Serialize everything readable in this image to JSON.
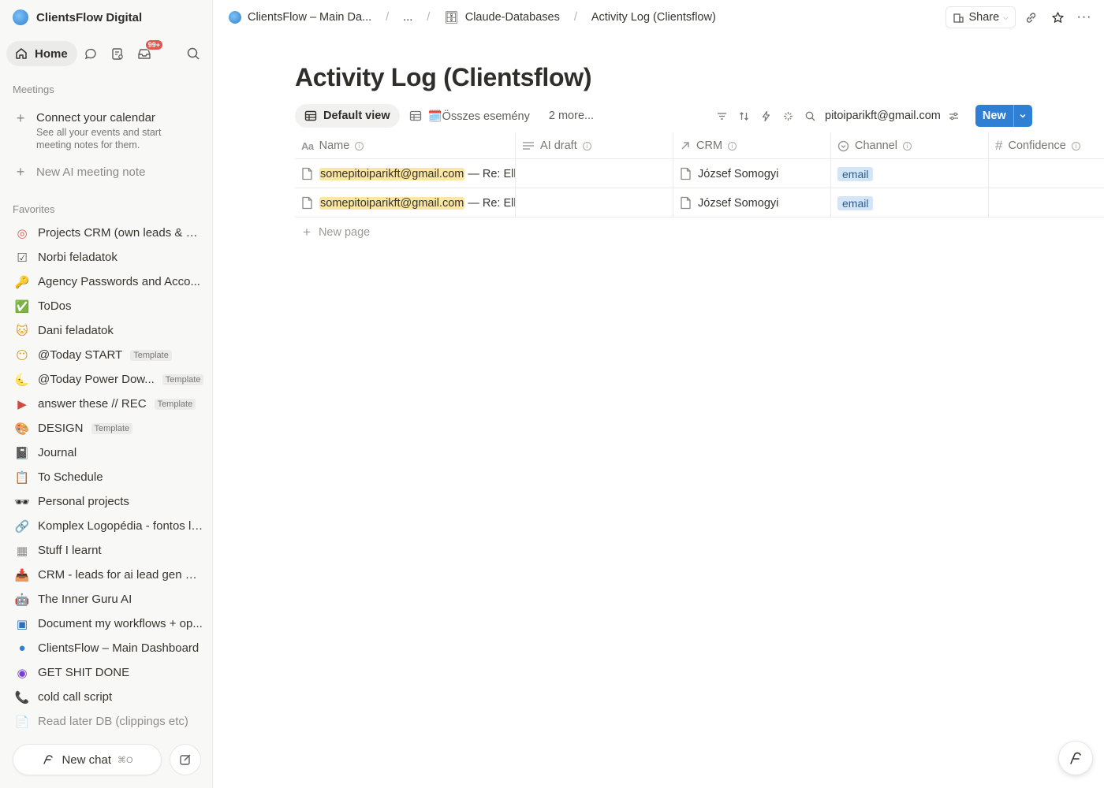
{
  "sidebar": {
    "workspace": "ClientsFlow Digital",
    "home_label": "Home",
    "inbox_badge": "99+",
    "meetings_label": "Meetings",
    "connect_calendar": "Connect your calendar",
    "connect_calendar_sub": "See all your events and start meeting notes for them.",
    "new_ai_note": "New AI meeting note",
    "favorites_label": "Favorites",
    "favorites": [
      {
        "icon": "target-icon",
        "glyph": "◎",
        "color": "#e0574e",
        "label": "Projects CRM (own leads & cl..."
      },
      {
        "icon": "checkbox-icon",
        "glyph": "☑",
        "color": "#555",
        "label": "Norbi feladatok"
      },
      {
        "icon": "key-icon",
        "glyph": "🔑",
        "color": "#c9962a",
        "label": "Agency Passwords and Acco..."
      },
      {
        "icon": "check-icon",
        "glyph": "✅",
        "color": "#3a9d46",
        "label": "ToDos"
      },
      {
        "icon": "cat-icon",
        "glyph": "🐱",
        "color": "#d49a2a",
        "label": "Dani feladatok"
      },
      {
        "icon": "smile-icon",
        "glyph": "😶",
        "color": "#d49a2a",
        "label": "@Today START",
        "template": "Template"
      },
      {
        "icon": "moon-icon",
        "glyph": "🌜",
        "color": "#d49a2a",
        "label": "@Today Power Dow...",
        "template": "Template"
      },
      {
        "icon": "video-icon",
        "glyph": "▶",
        "color": "#d0483f",
        "label": "answer these // REC",
        "template": "Template"
      },
      {
        "icon": "palette-icon",
        "glyph": "🎨",
        "color": "#b0763a",
        "label": "DESIGN",
        "template": "Template"
      },
      {
        "icon": "journal-icon",
        "glyph": "📓",
        "color": "#555",
        "label": "Journal"
      },
      {
        "icon": "schedule-icon",
        "glyph": "📋",
        "color": "#555",
        "label": "To Schedule"
      },
      {
        "icon": "sunglasses-icon",
        "glyph": "🕶",
        "color": "#222",
        "label": "Personal projects"
      },
      {
        "icon": "link-icon",
        "glyph": "🔗",
        "color": "#9b4fb0",
        "label": "Komplex Logopédia - fontos li..."
      },
      {
        "icon": "table-icon",
        "glyph": "▦",
        "color": "#8a8985",
        "label": "Stuff I learnt"
      },
      {
        "icon": "inbox-tray-icon",
        "glyph": "📥",
        "color": "#777",
        "label": "CRM - leads for ai lead gen of..."
      },
      {
        "icon": "robot-icon",
        "glyph": "🤖",
        "color": "#555",
        "label": "The Inner Guru AI"
      },
      {
        "icon": "chip-icon",
        "glyph": "▣",
        "color": "#2f6fb4",
        "label": "Document my workflows + op..."
      },
      {
        "icon": "clientsflow-icon",
        "glyph": "●",
        "color": "#2f7fd4",
        "label": "ClientsFlow – Main Dashboard"
      },
      {
        "icon": "focus-icon",
        "glyph": "◉",
        "color": "#7a3fd1",
        "label": "GET SHIT DONE"
      },
      {
        "icon": "phone-icon",
        "glyph": "📞",
        "color": "#3aaa4e",
        "label": "cold call script"
      },
      {
        "icon": "clipping-icon",
        "glyph": "📄",
        "color": "#777",
        "label": "Read later DB (clippings etc)"
      }
    ],
    "new_chat": "New chat",
    "new_chat_kbd": "⌘O"
  },
  "topbar": {
    "crumb1": "ClientsFlow – Main Da...",
    "crumb_more": "...",
    "crumb2": "Claude-Databases",
    "crumb3": "Activity Log (Clientsflow)",
    "share": "Share"
  },
  "page": {
    "title": "Activity Log (Clientsflow)",
    "views": {
      "default": "Default view",
      "second": "🗓️Összes esemény",
      "more": "2 more..."
    },
    "search_value": "pitoiparikft@gmail.com",
    "new_label": "New",
    "columns": [
      {
        "icon": "text-icon",
        "label": "Name"
      },
      {
        "icon": "lines-icon",
        "label": "AI draft"
      },
      {
        "icon": "relation-icon",
        "label": "CRM"
      },
      {
        "icon": "select-icon",
        "label": "Channel"
      },
      {
        "icon": "hash-icon",
        "label": "Confidence"
      }
    ],
    "rows": [
      {
        "email": "somepitoiparikft@gmail.com",
        "subject": " — Re: Ell",
        "crm": "József Somogyi",
        "channel": "email"
      },
      {
        "email": "somepitoiparikft@gmail.com",
        "subject": " — Re: Ell",
        "crm": "József Somogyi",
        "channel": "email"
      }
    ],
    "new_page": "New page"
  }
}
